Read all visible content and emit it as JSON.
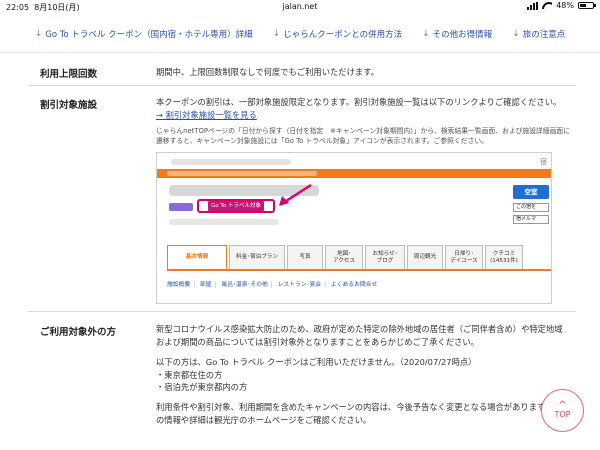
{
  "status": {
    "time": "22:05",
    "date": "8月10日(月)",
    "url": "jalan.net",
    "battery": "48%",
    "battery_level": 0.48
  },
  "anchor_nav": [
    {
      "icon": "down-arrow-icon",
      "label": "Go To トラベル クーポン（国内宿・ホテル専用）詳細"
    },
    {
      "icon": "down-arrow-icon",
      "label": "じゃらんクーポンとの併用方法"
    },
    {
      "icon": "down-arrow-icon",
      "label": "その他お得情報"
    },
    {
      "icon": "down-arrow-icon",
      "label": "旅の注意点"
    }
  ],
  "usage_limit": {
    "label": "利用上限回数",
    "text": "期間中、上限回数制限なしで何度でもご利用いただけます。"
  },
  "discount_facilities": {
    "label": "割引対象施設",
    "text": "本クーポンの割引は、一部対象施設限定となります。割引対象施設一覧は以下のリンクよりご確認ください。",
    "link": "→ 割引対象施設一覧を見る",
    "note": "じゃらんnetTOPページの「日付から探す（日付を指定　※キャンペーン対象期間内）」から、検索結果一覧画面、および施設詳細画面に遷移すると、キャンペーン対象施設には「Go To トラベル対象」アイコンが表示されます。ご参照ください。",
    "mock": {
      "corner_char": "宿",
      "goto_tag": "Go To トラベル対象",
      "vacancy_button": "空室",
      "small_buttons": [
        "この宿を",
        "宿メルマ"
      ],
      "tabs": [
        "基本情報",
        "料金･宿泊プラン",
        "写真",
        "地図･\nアクセス",
        "お知らせ･\nブログ",
        "周辺観光",
        "日帰り･\nデイユース",
        "クチコミ\n(14531件)"
      ],
      "active_tab": 0,
      "sublinks": [
        "施設概要",
        "部屋",
        "風呂･温泉･その他",
        "レストラン･宴会",
        "よくあるお問合せ"
      ]
    }
  },
  "not_eligible": {
    "label": "ご利用対象外の方",
    "p1": "新型コロナウイルス感染拡大防止のため、政府が定めた特定の除外地域の居住者（ご同伴者含め）や特定地域および期間の商品については割引対象外となりますことをあらかじめご了承ください。",
    "p2": "以下の方は、Go To トラベル クーポンはご利用いただけません。（2020/07/27時点）",
    "items": [
      "・東京都在住の方",
      "・宿泊先が東京都内の方"
    ],
    "p3": "利用条件や割引対象、利用期間を含めたキャンペーンの内容は、今後予告なく変更となる場合があります。新の情報や詳細は観光庁のホームページをご確認ください。"
  },
  "top_button": {
    "label": "TOP",
    "icon": "caret-up-icon"
  }
}
